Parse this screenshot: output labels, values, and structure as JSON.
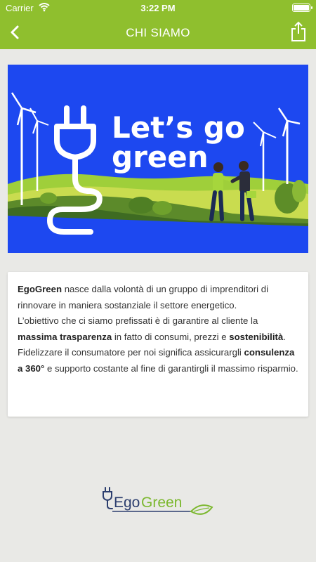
{
  "status_bar": {
    "carrier": "Carrier",
    "time": "3:22 PM"
  },
  "nav": {
    "title": "CHI SIAMO",
    "back_icon": "chevron-left-icon",
    "share_icon": "share-icon"
  },
  "banner": {
    "headline_line1": "Let’s go",
    "headline_line2": "green"
  },
  "about": {
    "p1_brand": "EgoGreen",
    "p1_rest": " nasce dalla volontà di un gruppo di imprenditori di rinnovare in maniera sostanziale il settore energetico.",
    "p2_start": "L’obiettivo che ci siamo prefissati è di garantire al cliente la ",
    "p2_bold1": "massima trasparenza",
    "p2_mid": " in fatto di consumi, prezzi e ",
    "p2_bold2": "sostenibilità",
    "p2_end": ".",
    "p3_start": "Fidelizzare il consumatore per noi significa assicurargli ",
    "p3_bold": "consulenza a 360°",
    "p3_end": " e supporto costante al fine di garantirgli il massimo risparmio."
  },
  "footer": {
    "logo_ego": "Ego",
    "logo_green": "Green"
  },
  "colors": {
    "accent": "#8fbf2e",
    "banner_blue": "#1d48f0",
    "logo_blue": "#2c3e6e",
    "logo_green": "#7cb82f"
  }
}
